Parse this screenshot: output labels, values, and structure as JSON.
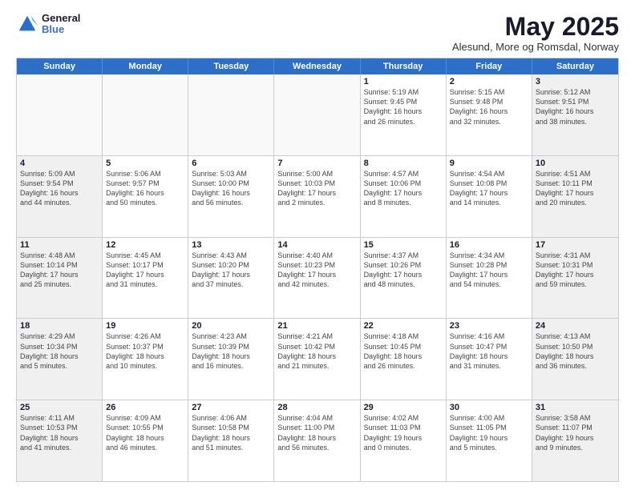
{
  "logo": {
    "general": "General",
    "blue": "Blue"
  },
  "title": "May 2025",
  "location": "Alesund, More og Romsdal, Norway",
  "days": [
    "Sunday",
    "Monday",
    "Tuesday",
    "Wednesday",
    "Thursday",
    "Friday",
    "Saturday"
  ],
  "weeks": [
    [
      {
        "day": "",
        "info": ""
      },
      {
        "day": "",
        "info": ""
      },
      {
        "day": "",
        "info": ""
      },
      {
        "day": "",
        "info": ""
      },
      {
        "day": "1",
        "info": "Sunrise: 5:19 AM\nSunset: 9:45 PM\nDaylight: 16 hours\nand 26 minutes."
      },
      {
        "day": "2",
        "info": "Sunrise: 5:15 AM\nSunset: 9:48 PM\nDaylight: 16 hours\nand 32 minutes."
      },
      {
        "day": "3",
        "info": "Sunrise: 5:12 AM\nSunset: 9:51 PM\nDaylight: 16 hours\nand 38 minutes."
      }
    ],
    [
      {
        "day": "4",
        "info": "Sunrise: 5:09 AM\nSunset: 9:54 PM\nDaylight: 16 hours\nand 44 minutes."
      },
      {
        "day": "5",
        "info": "Sunrise: 5:06 AM\nSunset: 9:57 PM\nDaylight: 16 hours\nand 50 minutes."
      },
      {
        "day": "6",
        "info": "Sunrise: 5:03 AM\nSunset: 10:00 PM\nDaylight: 16 hours\nand 56 minutes."
      },
      {
        "day": "7",
        "info": "Sunrise: 5:00 AM\nSunset: 10:03 PM\nDaylight: 17 hours\nand 2 minutes."
      },
      {
        "day": "8",
        "info": "Sunrise: 4:57 AM\nSunset: 10:06 PM\nDaylight: 17 hours\nand 8 minutes."
      },
      {
        "day": "9",
        "info": "Sunrise: 4:54 AM\nSunset: 10:08 PM\nDaylight: 17 hours\nand 14 minutes."
      },
      {
        "day": "10",
        "info": "Sunrise: 4:51 AM\nSunset: 10:11 PM\nDaylight: 17 hours\nand 20 minutes."
      }
    ],
    [
      {
        "day": "11",
        "info": "Sunrise: 4:48 AM\nSunset: 10:14 PM\nDaylight: 17 hours\nand 25 minutes."
      },
      {
        "day": "12",
        "info": "Sunrise: 4:45 AM\nSunset: 10:17 PM\nDaylight: 17 hours\nand 31 minutes."
      },
      {
        "day": "13",
        "info": "Sunrise: 4:43 AM\nSunset: 10:20 PM\nDaylight: 17 hours\nand 37 minutes."
      },
      {
        "day": "14",
        "info": "Sunrise: 4:40 AM\nSunset: 10:23 PM\nDaylight: 17 hours\nand 42 minutes."
      },
      {
        "day": "15",
        "info": "Sunrise: 4:37 AM\nSunset: 10:26 PM\nDaylight: 17 hours\nand 48 minutes."
      },
      {
        "day": "16",
        "info": "Sunrise: 4:34 AM\nSunset: 10:28 PM\nDaylight: 17 hours\nand 54 minutes."
      },
      {
        "day": "17",
        "info": "Sunrise: 4:31 AM\nSunset: 10:31 PM\nDaylight: 17 hours\nand 59 minutes."
      }
    ],
    [
      {
        "day": "18",
        "info": "Sunrise: 4:29 AM\nSunset: 10:34 PM\nDaylight: 18 hours\nand 5 minutes."
      },
      {
        "day": "19",
        "info": "Sunrise: 4:26 AM\nSunset: 10:37 PM\nDaylight: 18 hours\nand 10 minutes."
      },
      {
        "day": "20",
        "info": "Sunrise: 4:23 AM\nSunset: 10:39 PM\nDaylight: 18 hours\nand 16 minutes."
      },
      {
        "day": "21",
        "info": "Sunrise: 4:21 AM\nSunset: 10:42 PM\nDaylight: 18 hours\nand 21 minutes."
      },
      {
        "day": "22",
        "info": "Sunrise: 4:18 AM\nSunset: 10:45 PM\nDaylight: 18 hours\nand 26 minutes."
      },
      {
        "day": "23",
        "info": "Sunrise: 4:16 AM\nSunset: 10:47 PM\nDaylight: 18 hours\nand 31 minutes."
      },
      {
        "day": "24",
        "info": "Sunrise: 4:13 AM\nSunset: 10:50 PM\nDaylight: 18 hours\nand 36 minutes."
      }
    ],
    [
      {
        "day": "25",
        "info": "Sunrise: 4:11 AM\nSunset: 10:53 PM\nDaylight: 18 hours\nand 41 minutes."
      },
      {
        "day": "26",
        "info": "Sunrise: 4:09 AM\nSunset: 10:55 PM\nDaylight: 18 hours\nand 46 minutes."
      },
      {
        "day": "27",
        "info": "Sunrise: 4:06 AM\nSunset: 10:58 PM\nDaylight: 18 hours\nand 51 minutes."
      },
      {
        "day": "28",
        "info": "Sunrise: 4:04 AM\nSunset: 11:00 PM\nDaylight: 18 hours\nand 56 minutes."
      },
      {
        "day": "29",
        "info": "Sunrise: 4:02 AM\nSunset: 11:03 PM\nDaylight: 19 hours\nand 0 minutes."
      },
      {
        "day": "30",
        "info": "Sunrise: 4:00 AM\nSunset: 11:05 PM\nDaylight: 19 hours\nand 5 minutes."
      },
      {
        "day": "31",
        "info": "Sunrise: 3:58 AM\nSunset: 11:07 PM\nDaylight: 19 hours\nand 9 minutes."
      }
    ]
  ]
}
